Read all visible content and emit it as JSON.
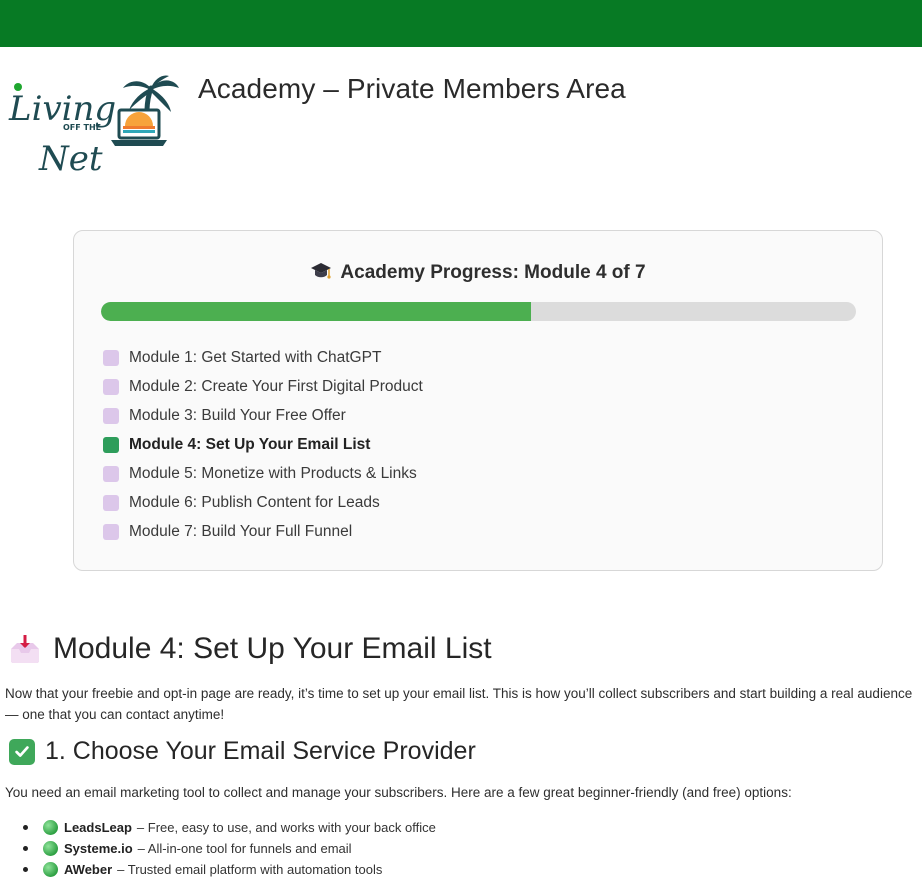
{
  "header": {
    "title": "Academy – Private Members Area",
    "accent_color": "#077a24"
  },
  "logo": {
    "line1": "Living",
    "line2": "OFF THE",
    "line3": "Net",
    "icon": "palm-tree-laptop-logo"
  },
  "progress": {
    "heading": "Academy Progress: Module 4 of 7",
    "heading_icon": "graduation-cap-icon",
    "current_module": 4,
    "total_modules": 7,
    "fill_fraction": 0.57,
    "fill_color": "#4caf50",
    "modules": [
      {
        "label": "Module 1: Get Started with ChatGPT",
        "current": false
      },
      {
        "label": "Module 2: Create Your First Digital Product",
        "current": false
      },
      {
        "label": "Module 3: Build Your Free Offer",
        "current": false
      },
      {
        "label": "Module 4: Set Up Your Email List",
        "current": true
      },
      {
        "label": "Module 5: Monetize with Products & Links",
        "current": false
      },
      {
        "label": "Module 6: Publish Content for Leads",
        "current": false
      },
      {
        "label": "Module 7: Build Your Full Funnel",
        "current": false
      }
    ]
  },
  "main": {
    "module_icon": "inbox-tray-icon",
    "module_title": "Module 4: Set Up Your Email List",
    "intro": "Now that your freebie and opt-in page are ready, it’s time to set up your email list. This is how you’ll collect subscribers and start building a real audience — one that you can contact anytime!",
    "section_icon": "check-mark-icon",
    "section_title": "1. Choose Your Email Service Provider",
    "section_text": "You need an email marketing tool to collect and manage your subscribers. Here are a few great beginner-friendly (and free) options:",
    "providers": [
      {
        "name": "LeadsLeap",
        "desc": "– Free, easy to use, and works with your back office"
      },
      {
        "name": "Systeme.io",
        "desc": "– All-in-one tool for funnels and email"
      },
      {
        "name": "AWeber",
        "desc": "– Trusted email platform with automation tools"
      }
    ]
  }
}
